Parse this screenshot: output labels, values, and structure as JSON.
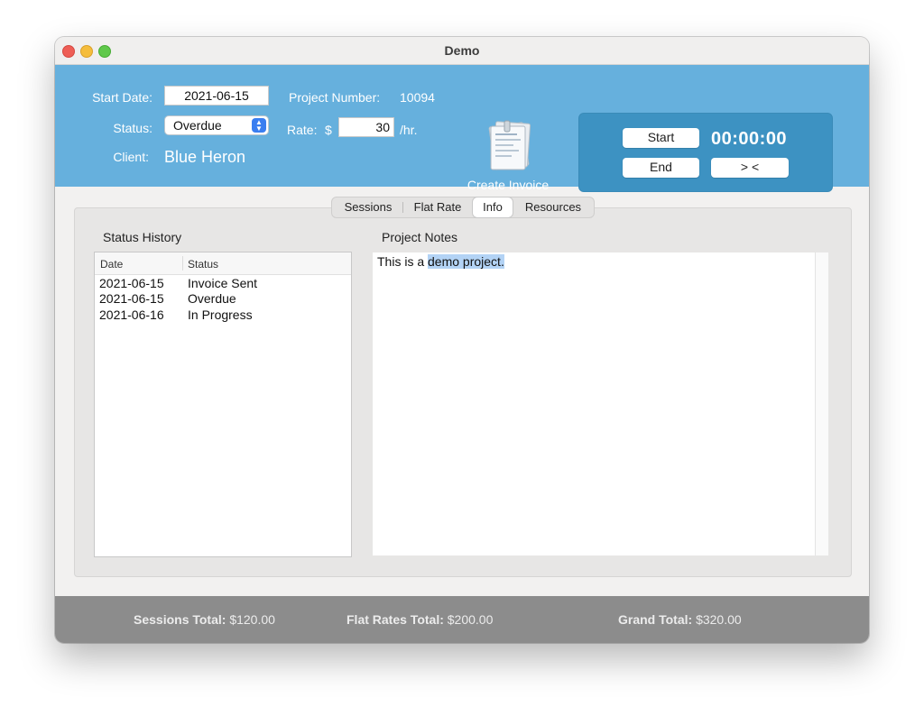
{
  "window": {
    "title": "Demo"
  },
  "header": {
    "start_date_label": "Start Date:",
    "start_date_value": "2021-06-15",
    "status_label": "Status:",
    "status_value": "Overdue",
    "client_label": "Client:",
    "client_value": "Blue Heron",
    "project_number_label": "Project Number:",
    "project_number_value": "10094",
    "rate_label": "Rate:",
    "rate_currency": "$",
    "rate_value": "30",
    "rate_unit": "/hr.",
    "create_invoice_label": "Create Invoice",
    "invoice_icon": "documents-icon"
  },
  "timer": {
    "start_label": "Start",
    "end_label": "End",
    "display": "00:00:00",
    "toggle_label": "> <"
  },
  "tabs": [
    {
      "label": "Sessions",
      "active": false
    },
    {
      "label": "Flat Rate",
      "active": false
    },
    {
      "label": "Info",
      "active": true
    },
    {
      "label": "Resources",
      "active": false
    }
  ],
  "status_history": {
    "title": "Status History",
    "columns": [
      "Date",
      "Status"
    ],
    "rows": [
      {
        "date": "2021-06-15",
        "status": "Invoice Sent"
      },
      {
        "date": "2021-06-15",
        "status": "Overdue"
      },
      {
        "date": "2021-06-16",
        "status": "In Progress"
      }
    ]
  },
  "notes": {
    "title": "Project Notes",
    "text_plain": "This is a ",
    "text_selected": "demo project."
  },
  "footer": {
    "sessions_total_label": "Sessions Total:",
    "sessions_total_value": "$120.00",
    "flat_rates_total_label": "Flat Rates Total:",
    "flat_rates_total_value": "$200.00",
    "grand_total_label": "Grand Total:",
    "grand_total_value": "$320.00"
  },
  "colors": {
    "header_bg": "#66b0dd",
    "timer_panel_bg": "#3d92c2",
    "footer_bg": "#8c8c8c",
    "selection": "#b3d3f5"
  }
}
